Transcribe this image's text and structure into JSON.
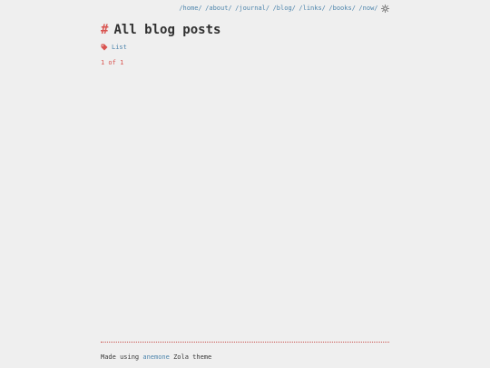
{
  "nav": {
    "links": [
      "/home/",
      "/about/",
      "/journal/",
      "/blog/",
      "/links/",
      "/books/",
      "/now/"
    ],
    "theme_toggle_icon": "sun-icon"
  },
  "page": {
    "title_prefix": "#",
    "title": "All blog posts"
  },
  "tags": {
    "icon": "tag-icon",
    "label": "List"
  },
  "pagination": {
    "text": "1 of 1"
  },
  "footer": {
    "prefix": "Made using ",
    "link": "anemone",
    "suffix": " Zola theme"
  },
  "colors": {
    "background": "#efefef",
    "link": "#4f86ad",
    "accent": "#d9534f",
    "text": "#3a3a3a"
  }
}
